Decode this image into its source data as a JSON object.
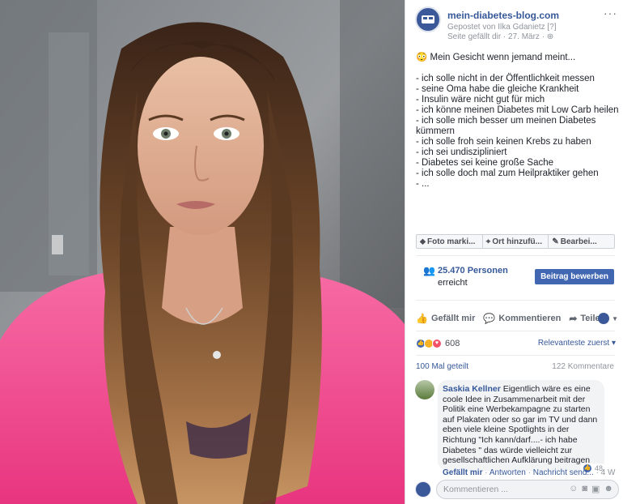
{
  "page": {
    "name": "mein-diabetes-blog.com",
    "posted_by": "Gepostet von Ilka Gdanietz [?]",
    "meta": "Seite gefällt dir · 27. März ·",
    "more": "···"
  },
  "post": {
    "emoji": "😳",
    "headline": "Mein Gesicht wenn jemand meint...",
    "lines": [
      "- ich solle nicht in der Öffentlichkeit messen",
      "- seine Oma habe die gleiche Krankheit",
      "- Insulin wäre nicht gut für mich",
      "- ich könne meinen Diabetes mit Low Carb heilen",
      "- ich solle mich besser um meinen Diabetes kümmern",
      "- ich solle froh sein keinen Krebs zu haben",
      "- ich sei undiszipliniert",
      "- Diabetes sei keine große Sache",
      "- ich solle doch mal zum Heilpraktiker gehen",
      "- ..."
    ]
  },
  "tagbar": {
    "photo": "Foto marki...",
    "place": "Ort hinzufü...",
    "edit": "Bearbei..."
  },
  "reach": {
    "count": "25.470 Personen",
    "label": "erreicht",
    "boost": "Beitrag bewerben"
  },
  "actions": {
    "like": "Gefällt mir",
    "comment": "Kommentieren",
    "share": "Teilen"
  },
  "reactions": {
    "count": "608",
    "sort": "Relevanteste zuerst ▾",
    "shares": "100 Mal geteilt",
    "comments": "122 Kommentare"
  },
  "comment": {
    "author": "Saskia Kellner",
    "text": "Eigentlich wäre es eine coole Idee in Zusammenarbeit mit der Politik eine Werbekampagne zu starten auf Plakaten oder so gar im TV und dann eben viele kleine Spotlights in der Richtung \"Ich kann/darf....- ich habe Diabetes \" das würde vielleicht zur gesellschaftlichen Aufklärung beitragen",
    "likes": "48",
    "like_action": "Gefällt mir",
    "reply_action": "Antworten",
    "message_action": "Nachricht send...",
    "time": "4 W"
  },
  "compose": {
    "placeholder": "Kommentieren ..."
  },
  "colors": {
    "link": "#365899",
    "button": "#4267b2",
    "shirt": "#f03c8c"
  }
}
